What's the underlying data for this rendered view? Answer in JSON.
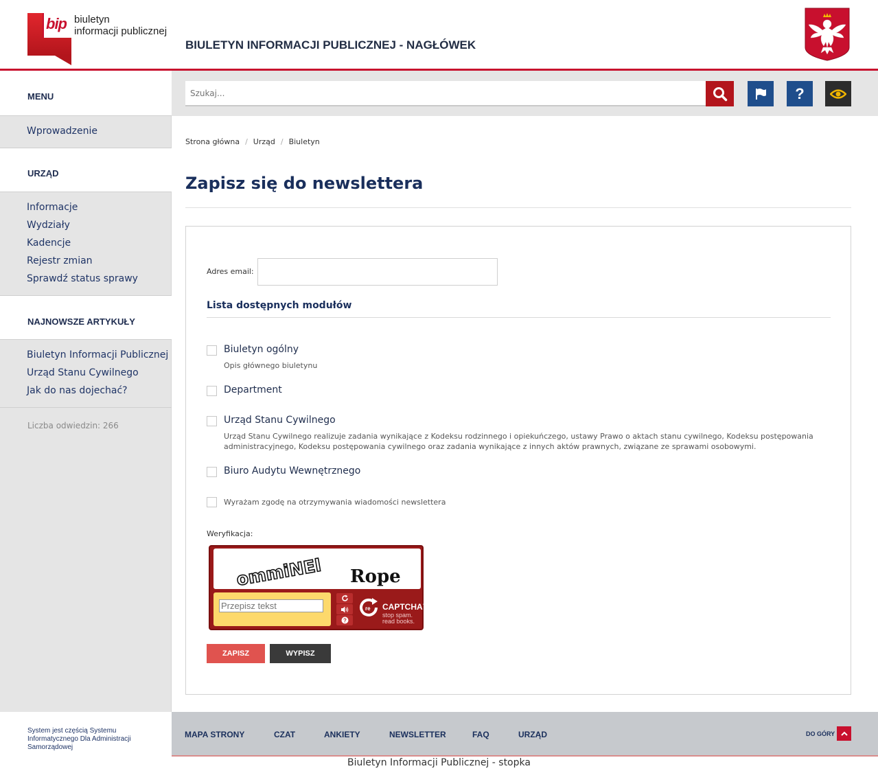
{
  "header": {
    "logo_word": "bip",
    "logo_text_1": "biuletyn",
    "logo_text_2": "informacji publicznej",
    "title": "BIULETYN INFORMACJI PUBLICZNEJ - NAGŁÓWEK"
  },
  "sidebar": {
    "menu_heading": "MENU",
    "menu_items": [
      {
        "label": "Wprowadzenie"
      }
    ],
    "office_heading": "URZĄD",
    "office_items": [
      {
        "label": "Informacje"
      },
      {
        "label": "Wydziały"
      },
      {
        "label": "Kadencje"
      },
      {
        "label": "Rejestr zmian"
      },
      {
        "label": "Sprawdź status sprawy"
      }
    ],
    "articles_heading": "NAJNOWSZE ARTYKUŁY",
    "articles_items": [
      {
        "label": "Biuletyn Informacji Publicznej"
      },
      {
        "label": "Urząd Stanu Cywilnego"
      },
      {
        "label": "Jak do nas dojechać?"
      }
    ],
    "visits": "Liczba odwiedzin: 266"
  },
  "toolbar": {
    "search_placeholder": "Szukaj...",
    "icons": [
      "search-icon",
      "flag-icon",
      "help-icon",
      "eye-icon"
    ],
    "help_glyph": "?"
  },
  "breadcrumb": {
    "items": [
      "Strona główna",
      "Urząd",
      "Biuletyn"
    ],
    "separator": "/"
  },
  "main": {
    "title": "Zapisz się do newslettera",
    "email_label": "Adres email:",
    "email_value": "",
    "modules_title": "Lista dostępnych modułów",
    "modules": [
      {
        "name": "Biuletyn ogólny",
        "description": "Opis głównego biuletynu"
      },
      {
        "name": "Department",
        "description": ""
      },
      {
        "name": "Urząd Stanu Cywilnego",
        "description": "Urząd Stanu Cywilnego realizuje zadania wynikające z Kodeksu rodzinnego i opiekuńczego, ustawy Prawo o aktach stanu cywilnego, Kodeksu postępowania administracyjnego, Kodeksu postępowania cywilnego oraz zadania wynikające z innych aktów prawnych, związane ze sprawami osobowymi."
      },
      {
        "name": "Biuro Audytu Wewnętrznego",
        "description": ""
      }
    ],
    "consent": "Wyrażam zgodę na otrzymywania wiadomości newslettera",
    "verification_label": "Weryfikacja:",
    "captcha": {
      "word_1": "ommiNEl",
      "word_2": "Rope",
      "input_placeholder": "Przepisz tekst",
      "brand_text": "CAPTCHA™",
      "slogan_1": "stop spam.",
      "slogan_2": "read books."
    },
    "save_label": "ZAPISZ",
    "unsubscribe_label": "WYPISZ"
  },
  "footer": {
    "system_text": "System jest częścią Systemu Informatycznego Dla Administracji Samorządowej",
    "links": [
      "MAPA STRONY",
      "CZAT",
      "ANKIETY",
      "NEWSLETTER",
      "FAQ",
      "URZĄD"
    ],
    "to_top": "DO GÓRY",
    "bottom_text": "Biuletyn Informacji Publicznej - stopka"
  },
  "colors": {
    "brand_red": "#c8102e",
    "navy": "#1a2f5c",
    "blue_button": "#1f4e8c",
    "dark_button": "#2c2c2c",
    "eye_yellow": "#f0b400"
  }
}
